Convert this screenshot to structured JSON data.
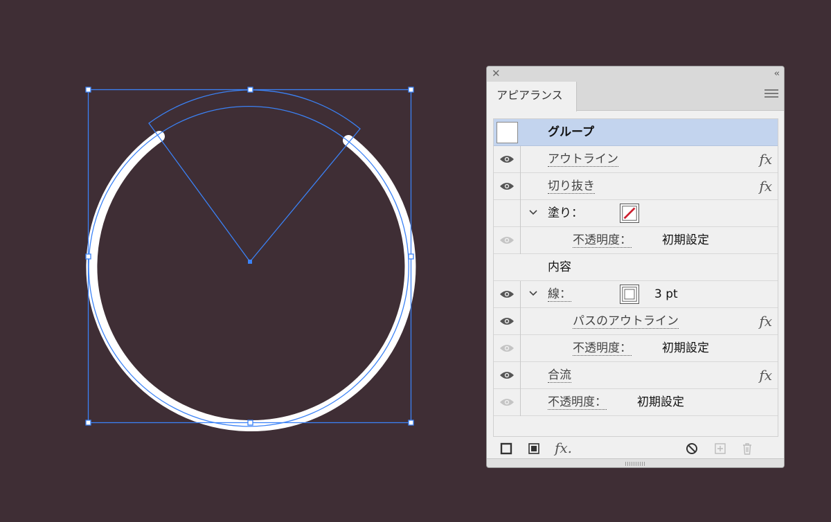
{
  "panel": {
    "title": "アピアランス",
    "close_glyph": "✕",
    "collapse_glyph": "‹‹"
  },
  "rows": {
    "group": "グループ",
    "outline": "アウトライン",
    "cutout": "切り抜き",
    "fill": "塗り：",
    "fill_opacity_label": "不透明度：",
    "fill_opacity_value": "初期設定",
    "contents": "内容",
    "stroke": "線：",
    "stroke_weight": "3 pt",
    "path_outline": "パスのアウトライン",
    "stroke_opacity_label": "不透明度：",
    "stroke_opacity_value": "初期設定",
    "merge": "合流",
    "opacity_label": "不透明度：",
    "opacity_value": "初期設定"
  },
  "fx_glyph": "fx",
  "bottom": {
    "fx_menu": "fx."
  },
  "icons": {
    "visible": "eye-icon",
    "hidden": "eye-dim-icon",
    "expand": "chevron-down-icon",
    "fill_swatch": "none-swatch-icon",
    "stroke_swatch": "white-stroke-swatch-icon"
  },
  "colors": {
    "background": "#3f2e35",
    "selection": "#3b82f6",
    "selected_row": "#c3d4ee",
    "none_slash": "#cc1f2f"
  }
}
